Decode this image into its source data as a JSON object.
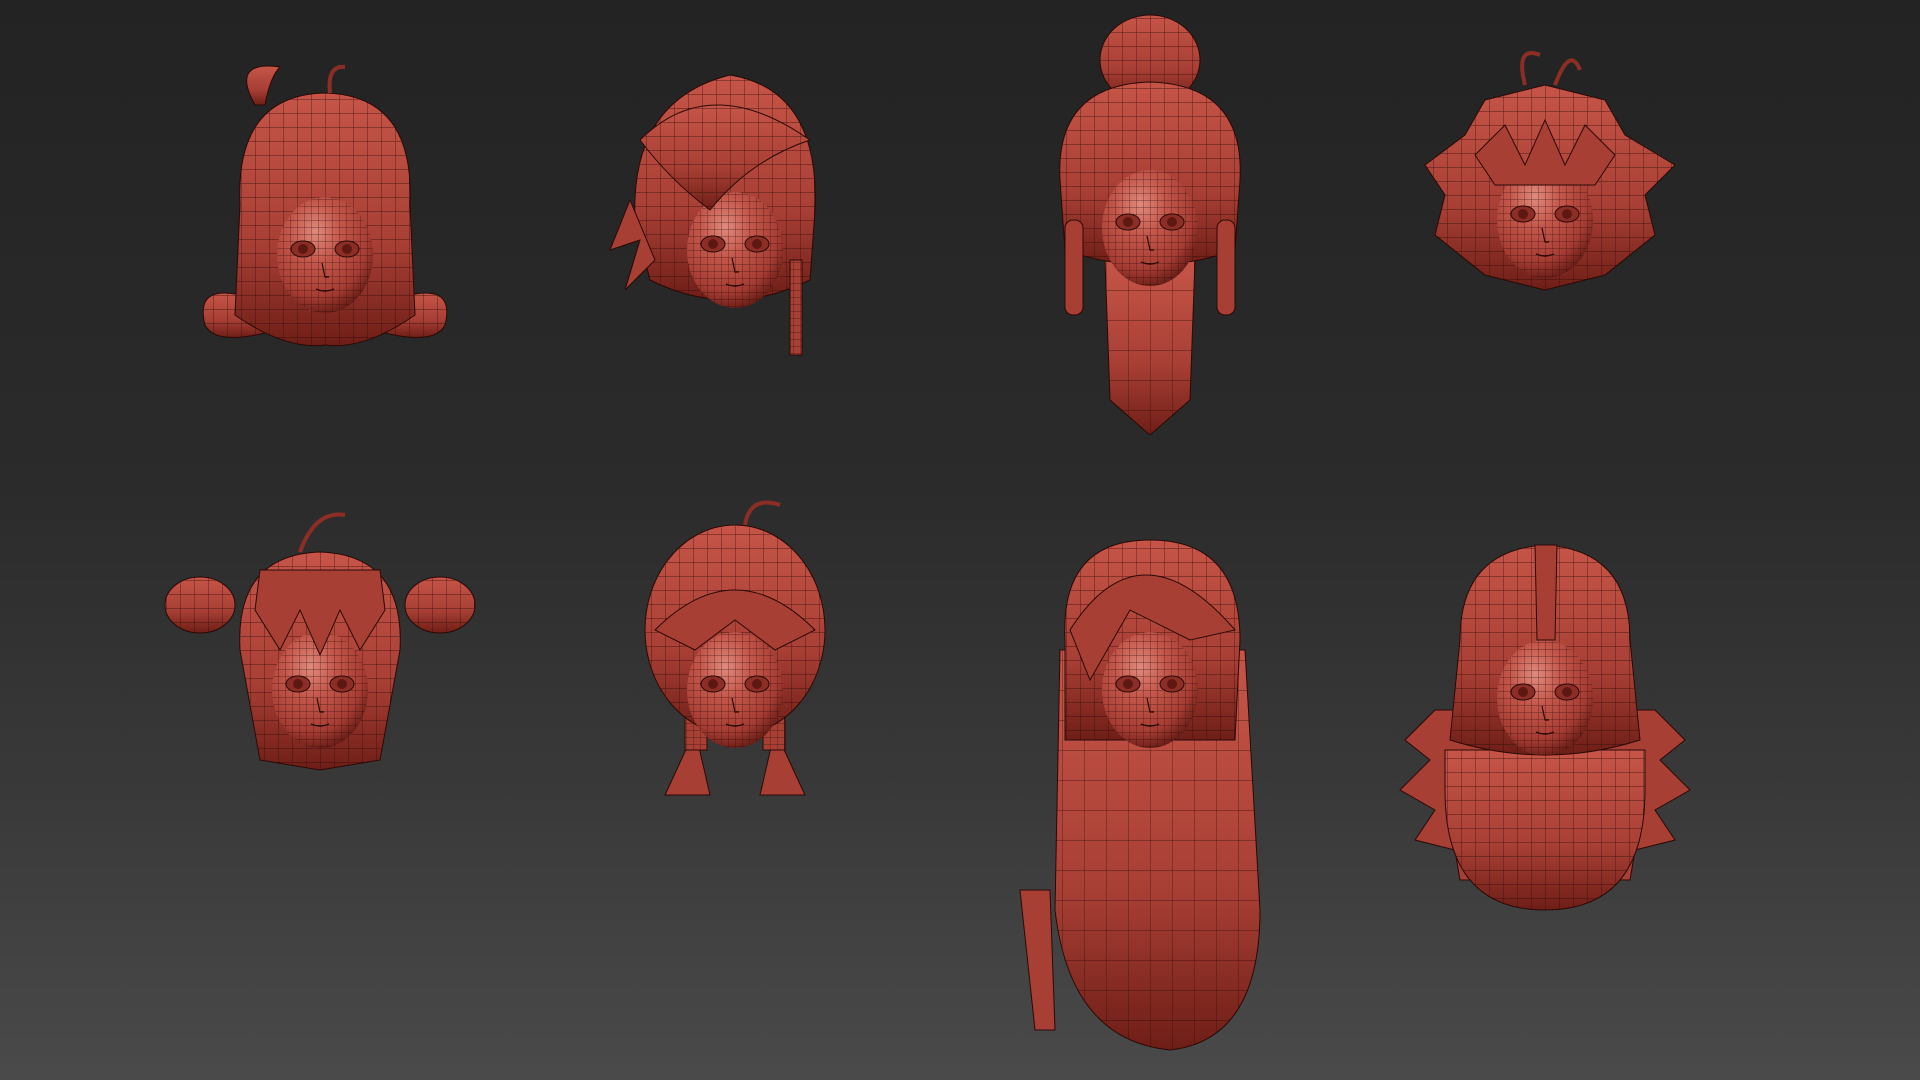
{
  "viewport": {
    "background_top": "#232323",
    "background_bottom": "#4a4a4a"
  },
  "material": {
    "base_color": "#b84a40",
    "highlight_color": "#e08a7d",
    "shadow_color": "#5e1812",
    "wire_color": "#2a0906"
  },
  "models": [
    {
      "name": "head-horn-curls"
    },
    {
      "name": "head-side-swept-braid"
    },
    {
      "name": "head-high-ponytail"
    },
    {
      "name": "head-messy-antenna"
    },
    {
      "name": "head-twin-buns"
    },
    {
      "name": "head-bob-braids"
    },
    {
      "name": "head-long-straight"
    },
    {
      "name": "head-wavy-long"
    }
  ]
}
